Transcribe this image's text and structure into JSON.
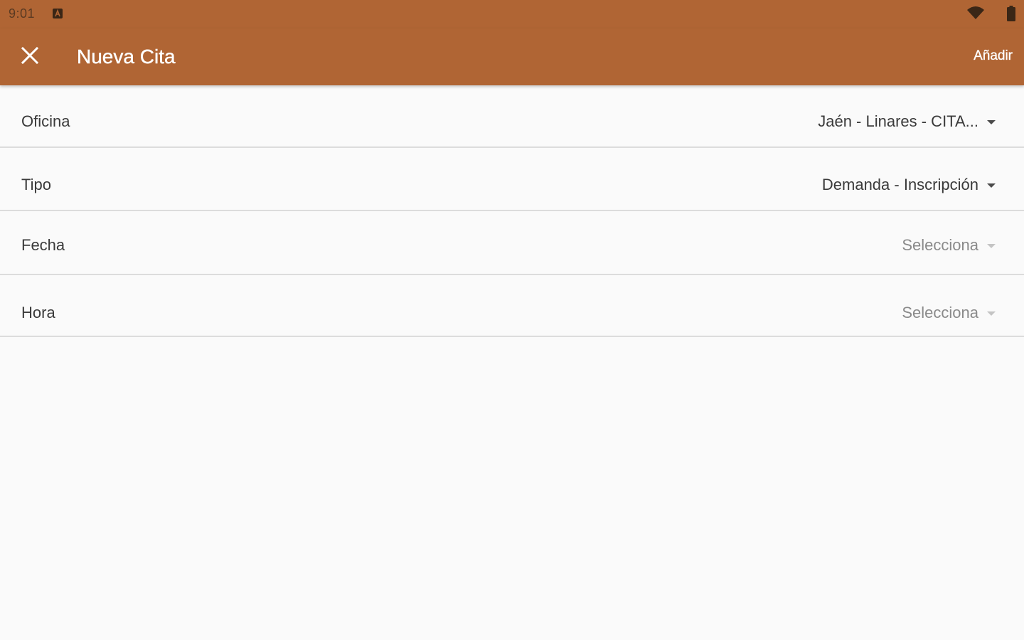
{
  "status_bar": {
    "time": "9:01",
    "notification_icon": "a-badge-icon",
    "wifi_icon": "wifi-icon",
    "battery_icon": "battery-icon"
  },
  "app_bar": {
    "close_icon": "close-icon",
    "title": "Nueva Cita",
    "action_label": "Añadir",
    "color": "#b06534"
  },
  "form": {
    "rows": [
      {
        "label": "Oficina",
        "value": "Jaén - Linares - CITA...",
        "placeholder": false
      },
      {
        "label": "Tipo",
        "value": "Demanda - Inscripción",
        "placeholder": false
      },
      {
        "label": "Fecha",
        "value": "Selecciona",
        "placeholder": true
      },
      {
        "label": "Hora",
        "value": "Selecciona",
        "placeholder": true
      }
    ]
  }
}
